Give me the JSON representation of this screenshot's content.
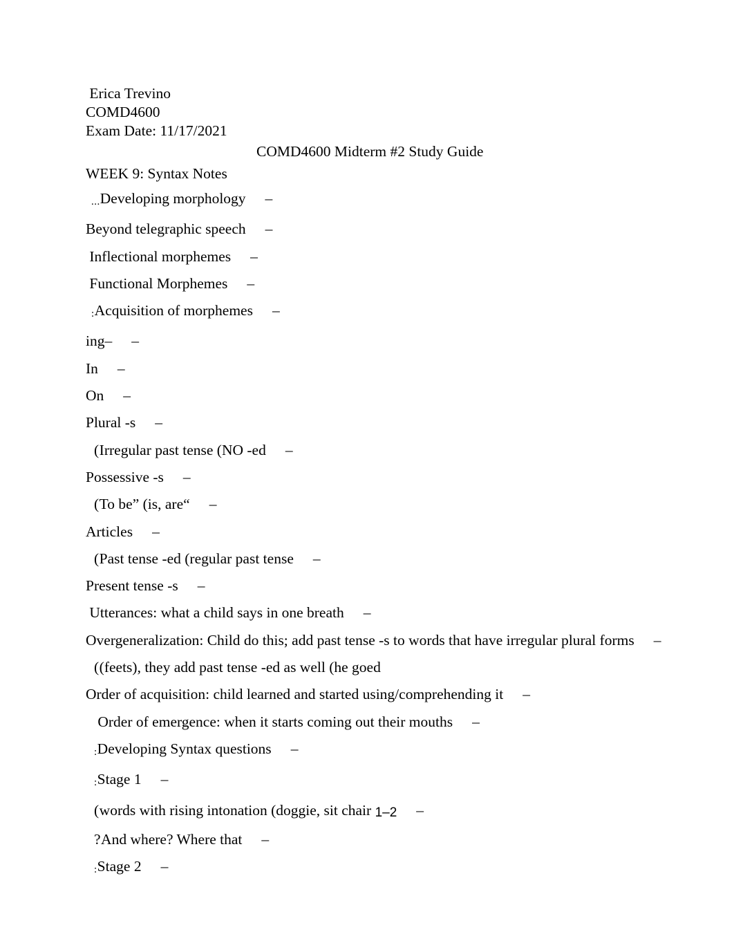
{
  "document": {
    "page_background": "#ffffff",
    "text_color": "#000000",
    "header": {
      "author": " Erica Trevino",
      "course": "COMD4600",
      "exam_date": "Exam Date: 11/17/2021"
    },
    "title": "COMD4600 Midterm #2 Study Guide",
    "section_heading": "WEEK 9: Syntax Notes",
    "bullet_marker": "–",
    "entries": [
      {
        "lead": "...",
        "lead_size": "small",
        "text": "Developing morphology",
        "indent": 2,
        "dash_gap": 28,
        "trailing_dash": true
      },
      {
        "lead": "",
        "lead_size": "small",
        "text": "Beyond telegraphic speech",
        "indent": 0,
        "dash_gap": 28,
        "trailing_dash": true
      },
      {
        "lead": "",
        "lead_size": "small",
        "text": " Inflectional morphemes",
        "indent": 0,
        "dash_gap": 28,
        "trailing_dash": true
      },
      {
        "lead": "",
        "lead_size": "small",
        "text": " Functional Morphemes",
        "indent": 0,
        "dash_gap": 28,
        "trailing_dash": true
      },
      {
        "lead": ":",
        "lead_size": "small",
        "text": "Acquisition of morphemes",
        "indent": 2,
        "dash_gap": 28,
        "trailing_dash": true
      },
      {
        "lead": "",
        "lead_size": "small",
        "text": "ing–",
        "indent": 0,
        "dash_gap": 28,
        "trailing_dash": true
      },
      {
        "lead": "",
        "lead_size": "small",
        "text": "In",
        "indent": 0,
        "dash_gap": 28,
        "trailing_dash": true
      },
      {
        "lead": "",
        "lead_size": "small",
        "text": "On",
        "indent": 0,
        "dash_gap": 28,
        "trailing_dash": true
      },
      {
        "lead": "",
        "lead_size": "small",
        "text": "Plural -s",
        "indent": 0,
        "dash_gap": 28,
        "trailing_dash": true
      },
      {
        "lead": "(",
        "lead_size": "big",
        "text": "Irregular past tense (NO -ed",
        "indent": 3,
        "dash_gap": 28,
        "trailing_dash": true
      },
      {
        "lead": "",
        "lead_size": "small",
        "text": "Possessive -s",
        "indent": 0,
        "dash_gap": 28,
        "trailing_dash": true
      },
      {
        "lead": "(",
        "lead_size": "big",
        "text": "To be” (is, are“",
        "indent": 3,
        "dash_gap": 28,
        "trailing_dash": true
      },
      {
        "lead": "",
        "lead_size": "small",
        "text": "Articles",
        "indent": 0,
        "dash_gap": 28,
        "trailing_dash": true
      },
      {
        "lead": "(",
        "lead_size": "big",
        "text": "Past tense -ed (regular past tense",
        "indent": 3,
        "dash_gap": 28,
        "trailing_dash": true
      },
      {
        "lead": "",
        "lead_size": "small",
        "text": "Present tense -s",
        "indent": 0,
        "dash_gap": 28,
        "trailing_dash": true
      },
      {
        "lead": "",
        "lead_size": "small",
        "text": " Utterances: what a child says in one breath",
        "indent": 0,
        "dash_gap": 28,
        "trailing_dash": true
      },
      {
        "lead": "",
        "lead_size": "small",
        "text": "Overgeneralization: Child do this; add past tense -s to words that have irregular plural forms",
        "indent": 0,
        "dash_gap": 28,
        "trailing_dash": true
      },
      {
        "lead": "(",
        "lead_size": "big",
        "text": "(feets), they add past tense -ed as well (he goed",
        "indent": 3,
        "dash_gap": 0,
        "trailing_dash": false
      },
      {
        "lead": "",
        "lead_size": "small",
        "text": "Order of acquisition: child learned and started using/comprehending it",
        "indent": 0,
        "dash_gap": 28,
        "trailing_dash": true
      },
      {
        "lead": "",
        "lead_size": "small",
        "text": " Order of emergence: when it starts coming out their mouths",
        "indent": 3,
        "dash_gap": 28,
        "trailing_dash": true
      },
      {
        "lead": ":",
        "lead_size": "small",
        "text": "Developing Syntax questions",
        "indent": 3,
        "dash_gap": 28,
        "trailing_dash": true
      },
      {
        "lead": ":",
        "lead_size": "small",
        "text": "Stage 1",
        "indent": 3,
        "dash_gap": 28,
        "trailing_dash": true
      },
      {
        "lead": "(",
        "lead_size": "big",
        "text": "words with rising intonation (doggie, sit chair ",
        "alt_text": "1–2",
        "indent": 3,
        "dash_gap": 28,
        "trailing_dash": true
      },
      {
        "lead": "?",
        "lead_size": "big",
        "text": "And where? Where that",
        "indent": 3,
        "dash_gap": 28,
        "trailing_dash": true
      },
      {
        "lead": ":",
        "lead_size": "small",
        "text": "Stage 2",
        "indent": 3,
        "dash_gap": 28,
        "trailing_dash": true
      }
    ]
  }
}
